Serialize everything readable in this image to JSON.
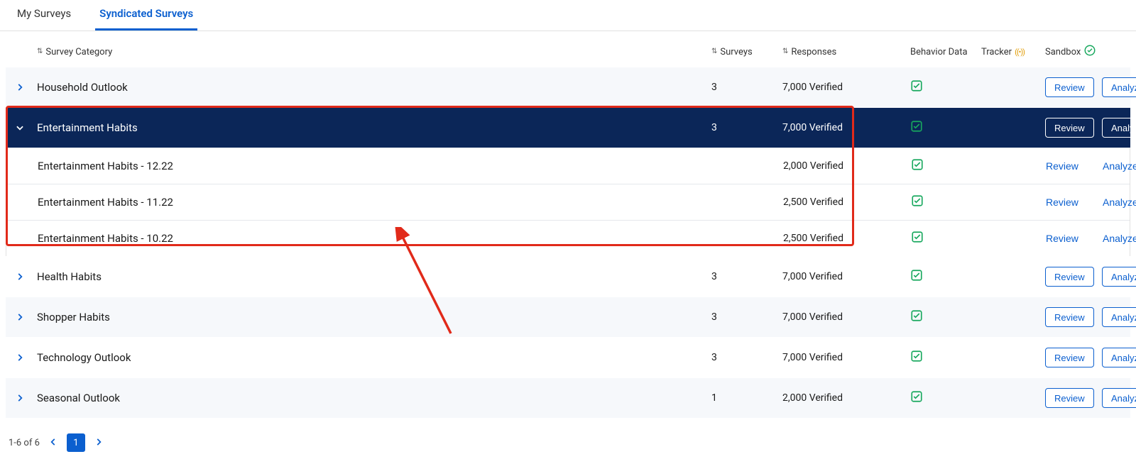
{
  "tabs": {
    "my": "My Surveys",
    "syndicated": "Syndicated Surveys"
  },
  "columns": {
    "category": "Survey Category",
    "surveys": "Surveys",
    "responses": "Responses",
    "behavior": "Behavior Data",
    "tracker": "Tracker",
    "sandbox": "Sandbox"
  },
  "buttons": {
    "review": "Review",
    "analyze": "Analyze"
  },
  "rows": [
    {
      "name": "Household Outlook",
      "surveys": "3",
      "responses": "7,000 Verified",
      "expanded": false
    },
    {
      "name": "Entertainment Habits",
      "surveys": "3",
      "responses": "7,000 Verified",
      "expanded": true,
      "children": [
        {
          "name": "Entertainment Habits - 12.22",
          "responses": "2,000 Verified"
        },
        {
          "name": "Entertainment Habits - 11.22",
          "responses": "2,500 Verified"
        },
        {
          "name": "Entertainment Habits - 10.22",
          "responses": "2,500 Verified"
        }
      ]
    },
    {
      "name": "Health Habits",
      "surveys": "3",
      "responses": "7,000 Verified",
      "expanded": false
    },
    {
      "name": "Shopper Habits",
      "surveys": "3",
      "responses": "7,000 Verified",
      "expanded": false
    },
    {
      "name": "Technology Outlook",
      "surveys": "3",
      "responses": "7,000 Verified",
      "expanded": false
    },
    {
      "name": "Seasonal Outlook",
      "surveys": "1",
      "responses": "2,000 Verified",
      "expanded": false
    }
  ],
  "pager": {
    "range": "1-6 of 6",
    "page": "1"
  }
}
